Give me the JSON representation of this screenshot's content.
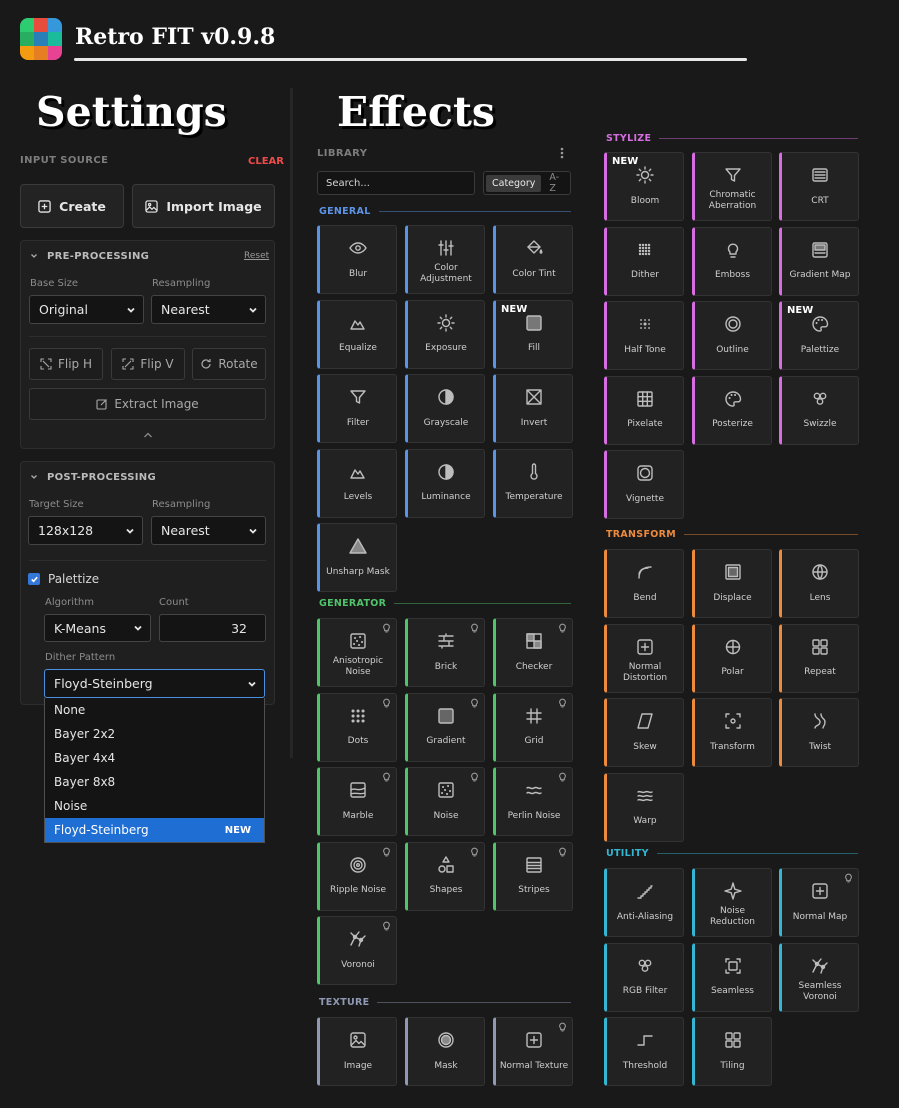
{
  "app": {
    "title": "Retro FIT v0.9.8",
    "logo_colors": [
      "#2ecc71",
      "#e74c3c",
      "#3498db",
      "#27ae60",
      "#2980b9",
      "#1abc9c",
      "#f39c12",
      "#e67e22",
      "#e84393"
    ]
  },
  "settings": {
    "heading": "Settings",
    "input_source": {
      "label": "INPUT SOURCE",
      "clear": "CLEAR",
      "create": "Create",
      "import": "Import Image"
    },
    "pre": {
      "title": "PRE-PROCESSING",
      "reset": "Reset",
      "base_size_label": "Base Size",
      "base_size": "Original",
      "resampling_label": "Resampling",
      "resampling": "Nearest",
      "flip_h": "Flip H",
      "flip_v": "Flip V",
      "rotate": "Rotate",
      "extract": "Extract Image"
    },
    "post": {
      "title": "POST-PROCESSING",
      "target_label": "Target Size",
      "target": "128x128",
      "resampling_label": "Resampling",
      "resampling": "Nearest",
      "palettize": "Palettize",
      "algorithm_label": "Algorithm",
      "algorithm": "K-Means",
      "count_label": "Count",
      "count": "32",
      "dither_label": "Dither Pattern",
      "dither": "Floyd-Steinberg",
      "options": [
        {
          "label": "None"
        },
        {
          "label": "Bayer 2x2"
        },
        {
          "label": "Bayer 4x4"
        },
        {
          "label": "Bayer 8x8"
        },
        {
          "label": "Noise"
        },
        {
          "label": "Floyd-Steinberg",
          "badge": "NEW",
          "selected": true
        }
      ]
    }
  },
  "effects": {
    "heading": "Effects",
    "library_label": "LIBRARY",
    "search_placeholder": "Search...",
    "sort_category": "Category",
    "sort_az": "A-Z",
    "new_badge": "NEW",
    "colors": {
      "general": "#5b93e6",
      "generator": "#4fc46a",
      "texture": "#8f99b3",
      "stylize": "#d66de0",
      "transform": "#ec8a3e",
      "utility": "#35b6d3"
    },
    "sections": [
      {
        "id": "general",
        "title": "GENERAL",
        "tiles": [
          {
            "name": "Blur",
            "icon": "eye"
          },
          {
            "name": "Color Adjustment",
            "icon": "sliders"
          },
          {
            "name": "Color Tint",
            "icon": "paint-bucket"
          },
          {
            "name": "Equalize",
            "icon": "mountain"
          },
          {
            "name": "Exposure",
            "icon": "sun"
          },
          {
            "name": "Fill",
            "icon": "square",
            "new": true
          },
          {
            "name": "Filter",
            "icon": "funnel"
          },
          {
            "name": "Grayscale",
            "icon": "half-circle"
          },
          {
            "name": "Invert",
            "icon": "box-x"
          },
          {
            "name": "Levels",
            "icon": "mountain"
          },
          {
            "name": "Luminance",
            "icon": "half-circle"
          },
          {
            "name": "Temperature",
            "icon": "thermometer"
          },
          {
            "name": "Unsharp Mask",
            "icon": "triangle"
          }
        ]
      },
      {
        "id": "generator",
        "title": "GENERATOR",
        "tiles": [
          {
            "name": "Anisotropic Noise",
            "icon": "noise-box",
            "bulb": true
          },
          {
            "name": "Brick",
            "icon": "brick",
            "bulb": true
          },
          {
            "name": "Checker",
            "icon": "checker",
            "bulb": true
          },
          {
            "name": "Dots",
            "icon": "dots",
            "bulb": true
          },
          {
            "name": "Gradient",
            "icon": "gradient-square",
            "bulb": true
          },
          {
            "name": "Grid",
            "icon": "hash",
            "bulb": true
          },
          {
            "name": "Marble",
            "icon": "marble",
            "bulb": true
          },
          {
            "name": "Noise",
            "icon": "noise-box",
            "bulb": true
          },
          {
            "name": "Perlin Noise",
            "icon": "waves",
            "bulb": true
          },
          {
            "name": "Ripple Noise",
            "icon": "target",
            "bulb": true
          },
          {
            "name": "Shapes",
            "icon": "shapes",
            "bulb": true
          },
          {
            "name": "Stripes",
            "icon": "stripes",
            "bulb": true
          },
          {
            "name": "Voronoi",
            "icon": "voronoi",
            "bulb": true
          }
        ]
      },
      {
        "id": "texture",
        "title": "TEXTURE",
        "tiles": [
          {
            "name": "Image",
            "icon": "image"
          },
          {
            "name": "Mask",
            "icon": "mask-circle"
          },
          {
            "name": "Normal Texture",
            "icon": "plus-square",
            "bulb": true
          }
        ]
      },
      {
        "id": "stylize",
        "title": "STYLIZE",
        "tiles": [
          {
            "name": "Bloom",
            "icon": "sun",
            "new": true
          },
          {
            "name": "Chromatic Aberration",
            "icon": "funnel"
          },
          {
            "name": "CRT",
            "icon": "crt"
          },
          {
            "name": "Dither",
            "icon": "dither-grid"
          },
          {
            "name": "Emboss",
            "icon": "bulb"
          },
          {
            "name": "Gradient Map",
            "icon": "gradient-map"
          },
          {
            "name": "Half Tone",
            "icon": "halftone"
          },
          {
            "name": "Outline",
            "icon": "ring"
          },
          {
            "name": "Palettize",
            "icon": "palette",
            "new": true
          },
          {
            "name": "Pixelate",
            "icon": "grid4"
          },
          {
            "name": "Posterize",
            "icon": "palette"
          },
          {
            "name": "Swizzle",
            "icon": "swizzle"
          },
          {
            "name": "Vignette",
            "icon": "vignette"
          }
        ]
      },
      {
        "id": "transform",
        "title": "TRANSFORM",
        "tiles": [
          {
            "name": "Bend",
            "icon": "bend"
          },
          {
            "name": "Displace",
            "icon": "displace"
          },
          {
            "name": "Lens",
            "icon": "globe"
          },
          {
            "name": "Normal Distortion",
            "icon": "plus-square"
          },
          {
            "name": "Polar",
            "icon": "polar"
          },
          {
            "name": "Repeat",
            "icon": "four-squares"
          },
          {
            "name": "Skew",
            "icon": "parallelogram"
          },
          {
            "name": "Transform",
            "icon": "focus"
          },
          {
            "name": "Twist",
            "icon": "twist"
          },
          {
            "name": "Warp",
            "icon": "warp"
          }
        ]
      },
      {
        "id": "utility",
        "title": "UTILITY",
        "tiles": [
          {
            "name": "Anti-Aliasing",
            "icon": "stairs-fine"
          },
          {
            "name": "Noise Reduction",
            "icon": "sparkle"
          },
          {
            "name": "Normal Map",
            "icon": "plus-square",
            "bulb": true
          },
          {
            "name": "RGB Filter",
            "icon": "swizzle"
          },
          {
            "name": "Seamless",
            "icon": "seamless"
          },
          {
            "name": "Seamless Voronoi",
            "icon": "voronoi"
          },
          {
            "name": "Threshold",
            "icon": "step"
          },
          {
            "name": "Tiling",
            "icon": "four-squares"
          }
        ]
      }
    ]
  }
}
